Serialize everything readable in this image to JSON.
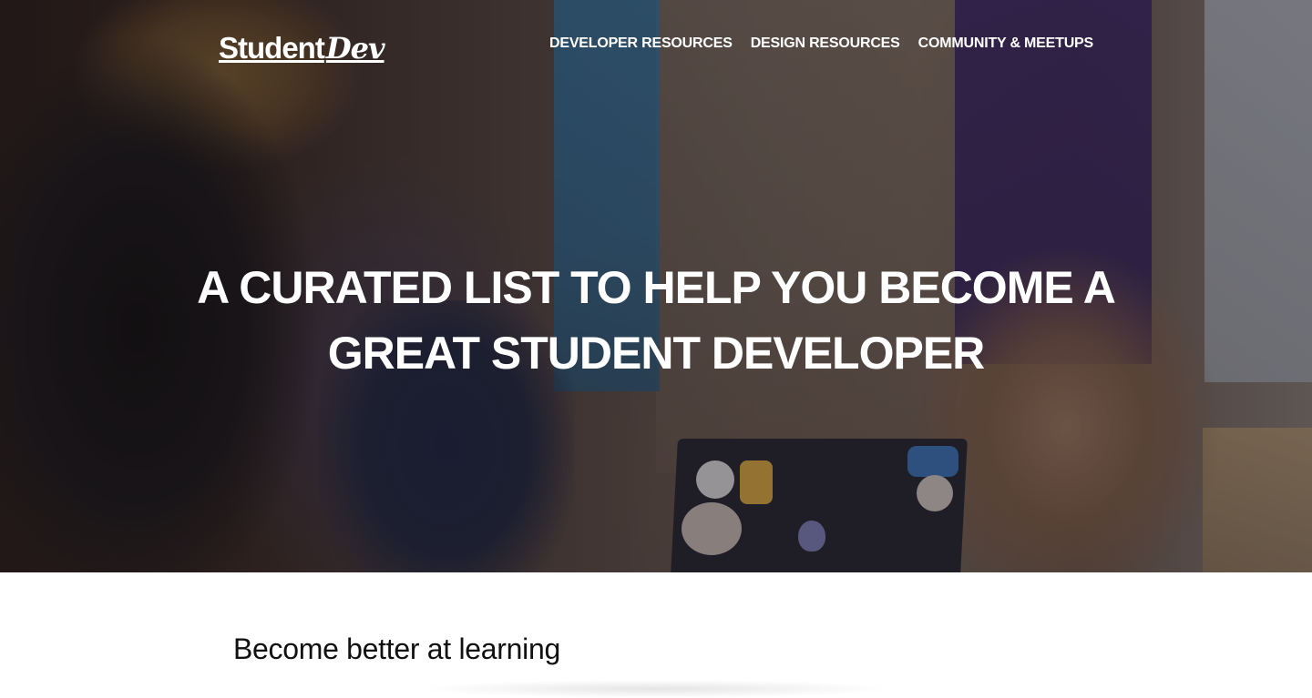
{
  "site": {
    "logo_main": "Student",
    "logo_script": "Dev"
  },
  "nav": {
    "items": [
      {
        "label": "DEVELOPER RESOURCES"
      },
      {
        "label": "DESIGN RESOURCES"
      },
      {
        "label": "COMMUNITY & MEETUPS"
      }
    ]
  },
  "hero": {
    "title_line1": "A CURATED LIST TO HELP YOU BECOME A",
    "title_line2": "GREAT STUDENT DEVELOPER",
    "image_description": "photo-students-around-laptop"
  },
  "content": {
    "section_heading": "Become better at learning"
  },
  "colors": {
    "hero_text": "#ffffff",
    "body_text": "#111111",
    "background": "#ffffff"
  }
}
